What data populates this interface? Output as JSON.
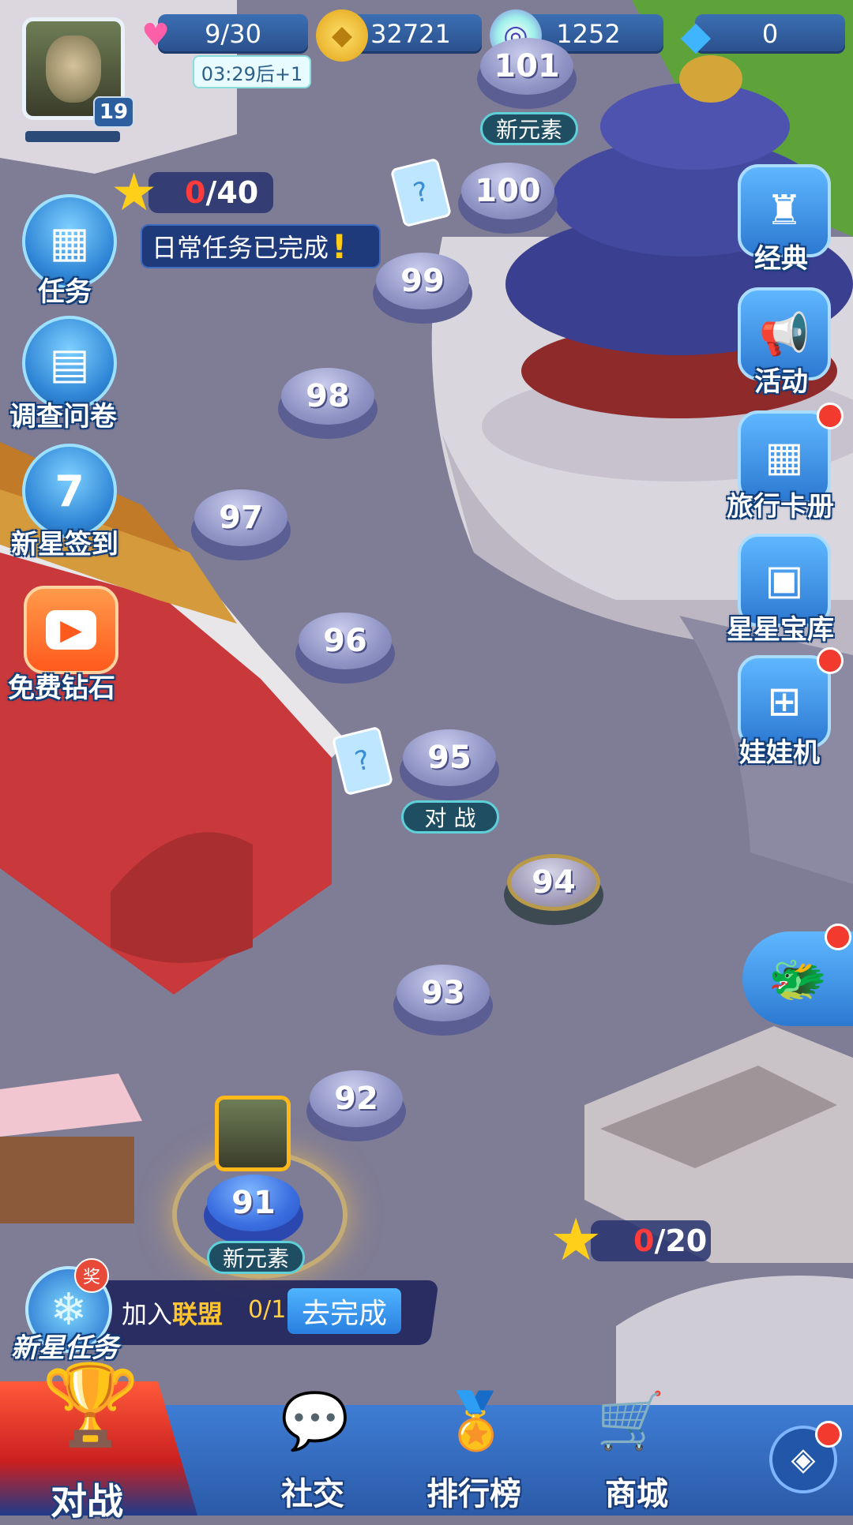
{
  "hud": {
    "player_level": "19",
    "hearts": "9/30",
    "heart_timer": "03:29后+1",
    "coins": "32721",
    "energy": "1252",
    "diamonds": "0"
  },
  "left_menu": {
    "stars_top_current": "0",
    "stars_top_total": "/40",
    "daily_tooltip": "日常任务已完成",
    "tasks": "任务",
    "survey": "调查问卷",
    "signin": "新星签到",
    "signin_day": "7",
    "free_diamonds": "免费钻石"
  },
  "right_menu": {
    "classic": "经典",
    "activity": "活动",
    "travel_cards": "旅行卡册",
    "star_vault": "星星宝库",
    "claw_machine": "娃娃机"
  },
  "levels": [
    "101",
    "100",
    "99",
    "98",
    "97",
    "96",
    "95",
    "94",
    "93",
    "92",
    "91"
  ],
  "level_tags": {
    "l101": "新元素",
    "l95": "对 战",
    "l91": "新元素"
  },
  "stars_bottom": {
    "current": "0",
    "total": "/20"
  },
  "newstar_task": {
    "title": "新星任务",
    "badge": "奖",
    "text_prefix": "加入",
    "text_highlight": "联盟",
    "progress": "0/1",
    "button": "去完成"
  },
  "bottom_nav": {
    "battle": "对战",
    "social": "社交",
    "ranking": "排行榜",
    "shop": "商城"
  },
  "colors": {
    "path": "#7d7a92",
    "node": "#8f93c4",
    "accent": "#2f86d6",
    "red_dot": "#f23a2e"
  }
}
